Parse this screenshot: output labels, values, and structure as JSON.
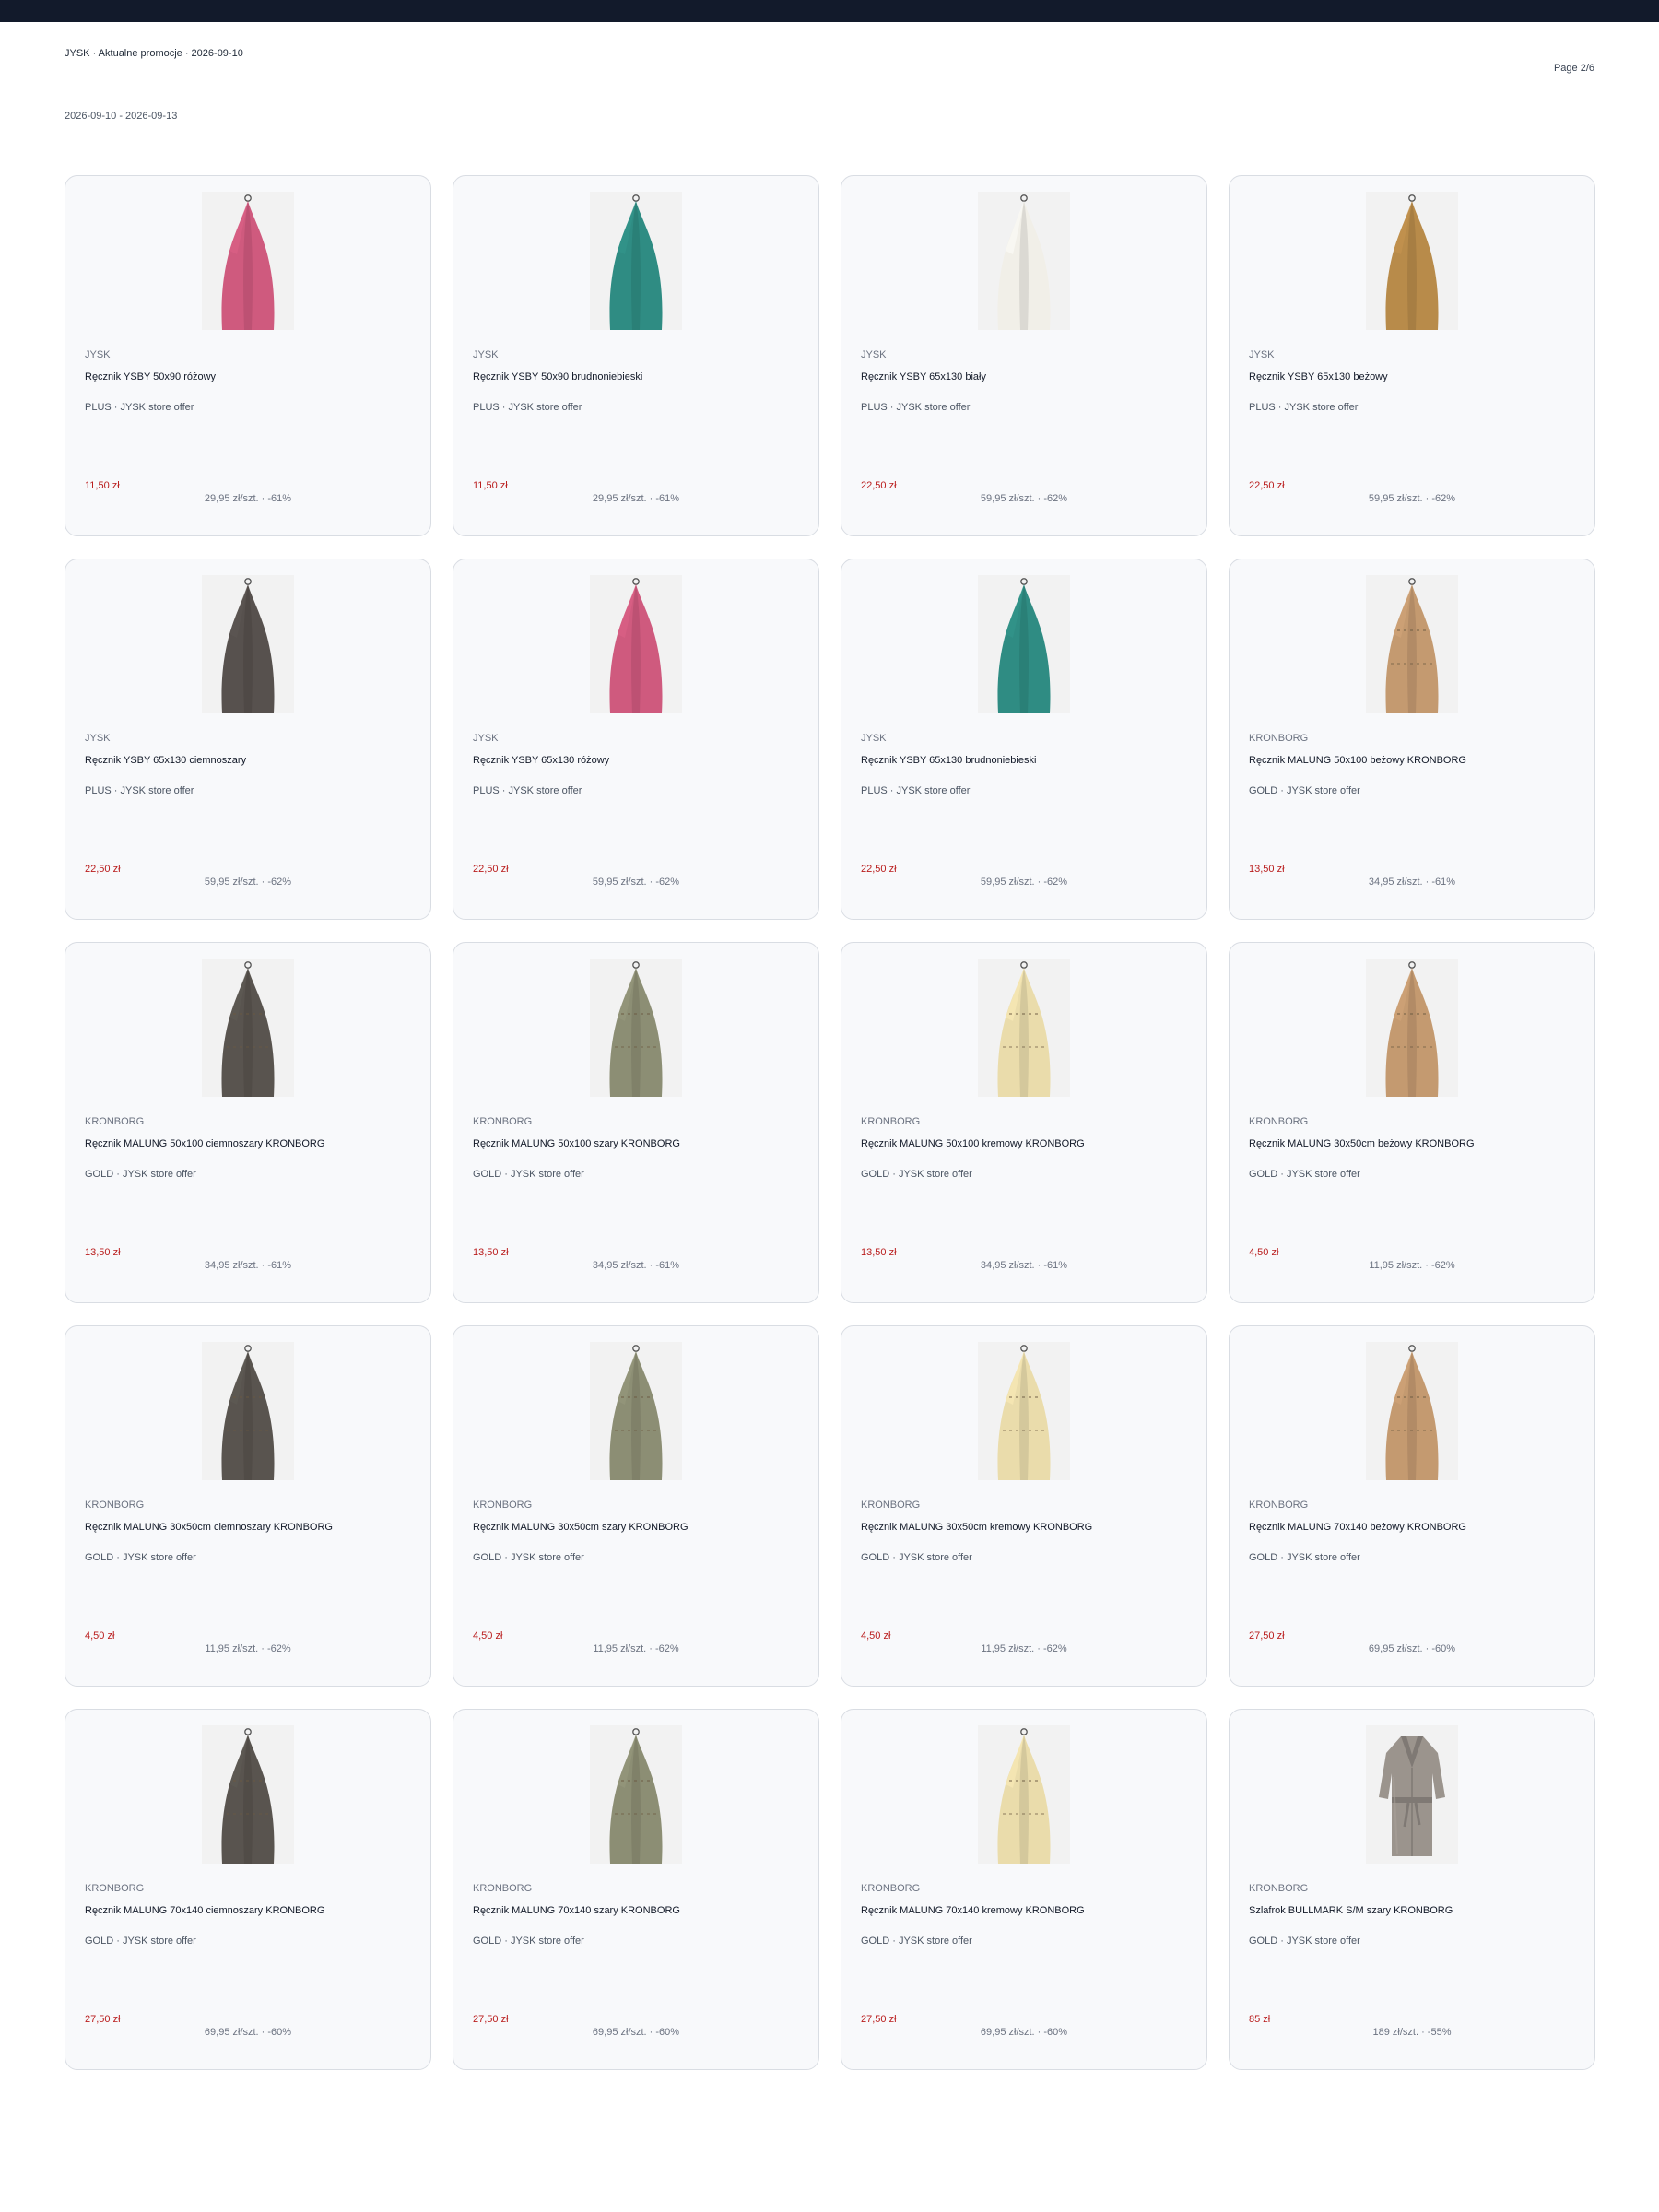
{
  "header": {
    "title": "JYSK · Aktualne promocje · 2026-09-10",
    "page": "Page 2/6",
    "date_range": "2026-09-10 - 2026-09-13"
  },
  "cards": [
    {
      "brand": "JYSK",
      "name": "Ręcznik YSBY 50x90 różowy",
      "offer": "PLUS · JYSK store offer",
      "price": "11,50 zł",
      "old": "29,95 zł/szt. · -61%",
      "image": "towel",
      "color": "#cf5a7e",
      "stripes": false
    },
    {
      "brand": "JYSK",
      "name": "Ręcznik YSBY 50x90 brudnoniebieski",
      "offer": "PLUS · JYSK store offer",
      "price": "11,50 zł",
      "old": "29,95 zł/szt. · -61%",
      "image": "towel",
      "color": "#2f8c83",
      "stripes": false
    },
    {
      "brand": "JYSK",
      "name": "Ręcznik YSBY 65x130 biały",
      "offer": "PLUS · JYSK store offer",
      "price": "22,50 zł",
      "old": "59,95 zł/szt. · -62%",
      "image": "towel",
      "color": "#f1efe8",
      "stripes": false
    },
    {
      "brand": "JYSK",
      "name": "Ręcznik YSBY 65x130 beżowy",
      "offer": "PLUS · JYSK store offer",
      "price": "22,50 zł",
      "old": "59,95 zł/szt. · -62%",
      "image": "towel",
      "color": "#b88b4a",
      "stripes": false
    },
    {
      "brand": "JYSK",
      "name": "Ręcznik YSBY 65x130 ciemnoszary",
      "offer": "PLUS · JYSK store offer",
      "price": "22,50 zł",
      "old": "59,95 zł/szt. · -62%",
      "image": "towel",
      "color": "#57514e",
      "stripes": false
    },
    {
      "brand": "JYSK",
      "name": "Ręcznik YSBY 65x130 różowy",
      "offer": "PLUS · JYSK store offer",
      "price": "22,50 zł",
      "old": "59,95 zł/szt. · -62%",
      "image": "towel",
      "color": "#cf5a7e",
      "stripes": false
    },
    {
      "brand": "JYSK",
      "name": "Ręcznik YSBY 65x130 brudnoniebieski",
      "offer": "PLUS · JYSK store offer",
      "price": "22,50 zł",
      "old": "59,95 zł/szt. · -62%",
      "image": "towel",
      "color": "#2f8c83",
      "stripes": false
    },
    {
      "brand": "KRONBORG",
      "name": "Ręcznik MALUNG 50x100 beżowy KRONBORG",
      "offer": "GOLD · JYSK store offer",
      "price": "13,50 zł",
      "old": "34,95 zł/szt. · -61%",
      "image": "towel",
      "color": "#c49a70",
      "stripes": true
    },
    {
      "brand": "KRONBORG",
      "name": "Ręcznik MALUNG 50x100 ciemnoszary KRONBORG",
      "offer": "GOLD · JYSK store offer",
      "price": "13,50 zł",
      "old": "34,95 zł/szt. · -61%",
      "image": "towel",
      "color": "#59544f",
      "stripes": true
    },
    {
      "brand": "KRONBORG",
      "name": "Ręcznik MALUNG 50x100 szary KRONBORG",
      "offer": "GOLD · JYSK store offer",
      "price": "13,50 zł",
      "old": "34,95 zł/szt. · -61%",
      "image": "towel",
      "color": "#8c8e74",
      "stripes": true
    },
    {
      "brand": "KRONBORG",
      "name": "Ręcznik MALUNG 50x100 kremowy KRONBORG",
      "offer": "GOLD · JYSK store offer",
      "price": "13,50 zł",
      "old": "34,95 zł/szt. · -61%",
      "image": "towel",
      "color": "#eadcab",
      "stripes": true
    },
    {
      "brand": "KRONBORG",
      "name": "Ręcznik MALUNG 30x50cm beżowy KRONBORG",
      "offer": "GOLD · JYSK store offer",
      "price": "4,50 zł",
      "old": "11,95 zł/szt. · -62%",
      "image": "towel",
      "color": "#c49a70",
      "stripes": true
    },
    {
      "brand": "KRONBORG",
      "name": "Ręcznik MALUNG 30x50cm ciemnoszary KRONBORG",
      "offer": "GOLD · JYSK store offer",
      "price": "4,50 zł",
      "old": "11,95 zł/szt. · -62%",
      "image": "towel",
      "color": "#59544f",
      "stripes": true
    },
    {
      "brand": "KRONBORG",
      "name": "Ręcznik MALUNG 30x50cm szary KRONBORG",
      "offer": "GOLD · JYSK store offer",
      "price": "4,50 zł",
      "old": "11,95 zł/szt. · -62%",
      "image": "towel",
      "color": "#8c8e74",
      "stripes": true
    },
    {
      "brand": "KRONBORG",
      "name": "Ręcznik MALUNG 30x50cm kremowy KRONBORG",
      "offer": "GOLD · JYSK store offer",
      "price": "4,50 zł",
      "old": "11,95 zł/szt. · -62%",
      "image": "towel",
      "color": "#eadcab",
      "stripes": true
    },
    {
      "brand": "KRONBORG",
      "name": "Ręcznik MALUNG 70x140 beżowy KRONBORG",
      "offer": "GOLD · JYSK store offer",
      "price": "27,50 zł",
      "old": "69,95 zł/szt. · -60%",
      "image": "towel",
      "color": "#c49a70",
      "stripes": true
    },
    {
      "brand": "KRONBORG",
      "name": "Ręcznik MALUNG 70x140 ciemnoszary KRONBORG",
      "offer": "GOLD · JYSK store offer",
      "price": "27,50 zł",
      "old": "69,95 zł/szt. · -60%",
      "image": "towel",
      "color": "#59544f",
      "stripes": true
    },
    {
      "brand": "KRONBORG",
      "name": "Ręcznik MALUNG 70x140 szary KRONBORG",
      "offer": "GOLD · JYSK store offer",
      "price": "27,50 zł",
      "old": "69,95 zł/szt. · -60%",
      "image": "towel",
      "color": "#8c8e74",
      "stripes": true
    },
    {
      "brand": "KRONBORG",
      "name": "Ręcznik MALUNG 70x140 kremowy KRONBORG",
      "offer": "GOLD · JYSK store offer",
      "price": "27,50 zł",
      "old": "69,95 zł/szt. · -60%",
      "image": "towel",
      "color": "#eadcab",
      "stripes": true
    },
    {
      "brand": "KRONBORG",
      "name": "Szlafrok BULLMARK S/M szary KRONBORG",
      "offer": "GOLD · JYSK store offer",
      "price": "85 zł",
      "old": "189 zł/szt. · -55%",
      "image": "bathrobe",
      "color": "#9b948d",
      "stripes": false
    }
  ]
}
